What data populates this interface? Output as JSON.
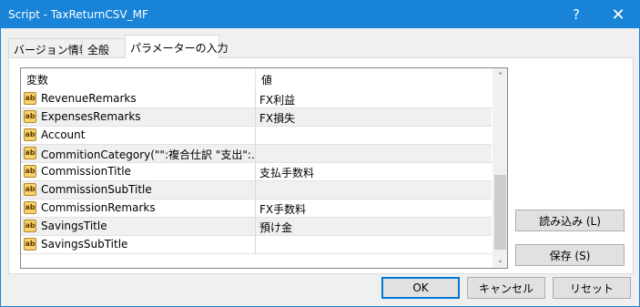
{
  "window": {
    "title": "Script - TaxReturnCSV_MF",
    "help_glyph": "?",
    "close_glyph": "✕"
  },
  "tabs": [
    {
      "label": "バージョン情報",
      "active": false
    },
    {
      "label": "全般",
      "active": false
    },
    {
      "label": "パラメーターの入力",
      "active": true
    }
  ],
  "grid": {
    "headers": {
      "variable": "変数",
      "value": "値"
    },
    "rows": [
      {
        "name": "RevenueRemarks",
        "value": "FX利益"
      },
      {
        "name": "ExpensesRemarks",
        "value": "FX損失"
      },
      {
        "name": "Account",
        "value": ""
      },
      {
        "name": "CommitionCategory(\"\":複合仕訳 \"支出\":…",
        "value": ""
      },
      {
        "name": "CommissionTitle",
        "value": "支払手数料"
      },
      {
        "name": "CommissionSubTitle",
        "value": ""
      },
      {
        "name": "CommissionRemarks",
        "value": "FX手数料"
      },
      {
        "name": "SavingsTitle",
        "value": "預け金"
      },
      {
        "name": "SavingsSubTitle",
        "value": ""
      }
    ],
    "row_icon_text": "ab",
    "scroll_up_glyph": "⌃",
    "scroll_down_glyph": "⌄"
  },
  "side_buttons": {
    "load": "読み込み (L)",
    "save": "保存 (S)"
  },
  "footer_buttons": {
    "ok": "OK",
    "cancel": "キャンセル",
    "reset": "リセット"
  },
  "colors": {
    "titlebar": "#1883d7",
    "alt_row": "#f0f0f0",
    "default_button_border": "#0078d7"
  }
}
